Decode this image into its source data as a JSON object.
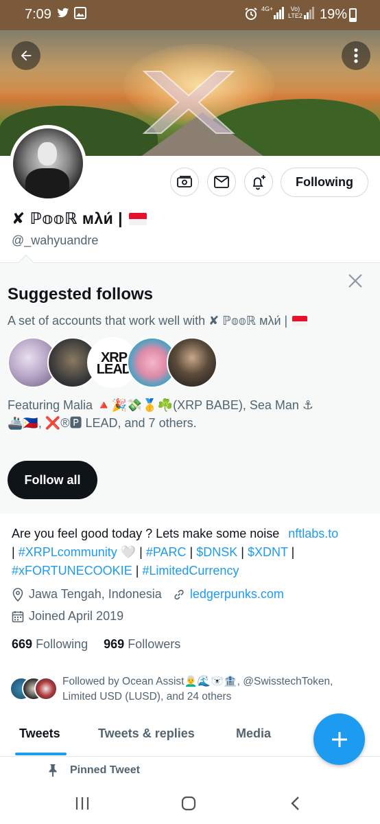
{
  "status_bar": {
    "time": "7:09",
    "net1": "4G+",
    "net2": "Vo)\nLTE2",
    "battery": "19%"
  },
  "profile": {
    "display_name": "✘ ℙ𝕠𝕠ℝ мλи́ |",
    "handle": "@_wahyuandre",
    "following_button": "Following"
  },
  "suggested": {
    "title": "Suggested follows",
    "subtitle": "A set of accounts that work well with ✘ ℙ𝕠𝕠ℝ мλи́ |",
    "featuring_line1": "Featuring Malia 🔺🎉💸🥇☘️(XRP BABE), Sea Man ⚓",
    "featuring_line2": "🚢🇵🇭, ❌®🅿 LEAD, and 7 others.",
    "avatar_label": "XRP LEAD",
    "follow_all": "Follow all"
  },
  "bio": {
    "line1_text": "Are you feel good today ? Lets make some noise ",
    "line1_link": "nftlabs.to",
    "line2": [
      {
        "t": "| ",
        "link": false
      },
      {
        "t": "#XRPLcommunity",
        "link": true
      },
      {
        "t": " 🤍 | ",
        "link": false
      },
      {
        "t": "#PARC",
        "link": true
      },
      {
        "t": " | ",
        "link": false
      },
      {
        "t": "$DNSK",
        "link": true
      },
      {
        "t": " | ",
        "link": false
      },
      {
        "t": "$XDNT",
        "link": true
      },
      {
        "t": " |",
        "link": false
      }
    ],
    "line3": [
      {
        "t": "#xFORTUNECOOKIE",
        "link": true
      },
      {
        "t": " | ",
        "link": false
      },
      {
        "t": "#LimitedCurrency",
        "link": true
      }
    ],
    "location": "Jawa Tengah, Indonesia",
    "website": "ledgerpunks.com",
    "joined": "Joined April 2019"
  },
  "counts": {
    "following_num": "669",
    "following_label": "Following",
    "followers_num": "969",
    "followers_label": "Followers"
  },
  "followed_by": "Followed by Ocean Assist👨‍🦳🌊🐻‍❄️🏦, @SwisstechToken, Limited USD (LUSD), and 24 others",
  "tabs": [
    "Tweets",
    "Tweets & replies",
    "Media"
  ],
  "pinned": "Pinned Tweet",
  "colors": {
    "accent": "#1d9bf0",
    "text": "#0f1419",
    "secondary": "#536471",
    "status_bar": "#7a5a3a"
  }
}
